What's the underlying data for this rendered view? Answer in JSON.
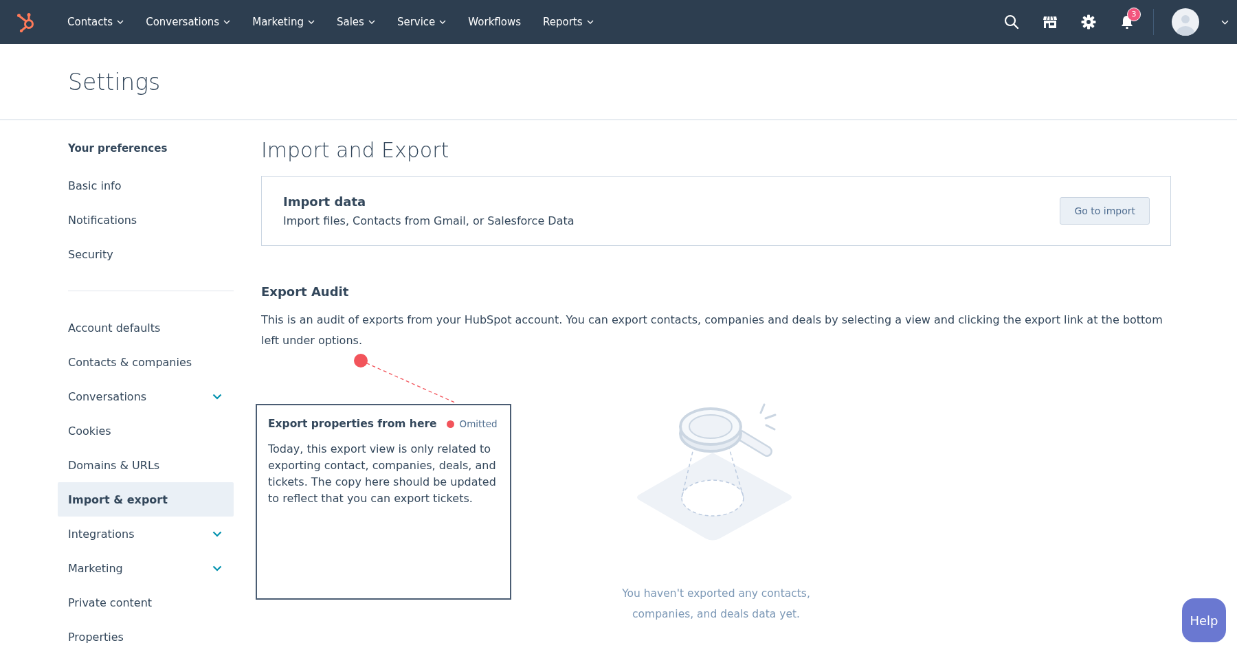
{
  "nav": {
    "items": [
      {
        "label": "Contacts",
        "has_menu": true
      },
      {
        "label": "Conversations",
        "has_menu": true
      },
      {
        "label": "Marketing",
        "has_menu": true
      },
      {
        "label": "Sales",
        "has_menu": true
      },
      {
        "label": "Service",
        "has_menu": true
      },
      {
        "label": "Workflows",
        "has_menu": false
      },
      {
        "label": "Reports",
        "has_menu": true
      }
    ],
    "notification_count": "3"
  },
  "page_title": "Settings",
  "sidebar": {
    "heading": "Your preferences",
    "groups": [
      [
        {
          "label": "Basic info",
          "expandable": false,
          "selected": false
        },
        {
          "label": "Notifications",
          "expandable": false,
          "selected": false
        },
        {
          "label": "Security",
          "expandable": false,
          "selected": false
        }
      ],
      [
        {
          "label": "Account defaults",
          "expandable": false,
          "selected": false
        },
        {
          "label": "Contacts & companies",
          "expandable": false,
          "selected": false
        },
        {
          "label": "Conversations",
          "expandable": true,
          "selected": false
        },
        {
          "label": "Cookies",
          "expandable": false,
          "selected": false
        },
        {
          "label": "Domains & URLs",
          "expandable": false,
          "selected": false
        },
        {
          "label": "Import & export",
          "expandable": false,
          "selected": true
        },
        {
          "label": "Integrations",
          "expandable": true,
          "selected": false
        },
        {
          "label": "Marketing",
          "expandable": true,
          "selected": false
        },
        {
          "label": "Private content",
          "expandable": false,
          "selected": false
        },
        {
          "label": "Properties",
          "expandable": false,
          "selected": false
        }
      ]
    ]
  },
  "main": {
    "title": "Import and Export",
    "import_card": {
      "title": "Import data",
      "description": "Import files, Contacts from Gmail, or Salesforce Data",
      "button": "Go to import"
    },
    "audit": {
      "heading": "Export Audit",
      "description": "This is an audit of exports from your HubSpot account. You can export contacts, companies and deals by selecting a view and clicking the export link at the bottom left under options.",
      "empty_message": "You haven't exported any contacts, companies, and deals data yet."
    }
  },
  "annotation": {
    "title": "Export properties from here",
    "status": "Omitted",
    "color": "#f2545b",
    "body": "Today, this export view is only related to exporting contact, companies, deals, and tickets. The copy here should be updated to reflect that you can export tickets."
  },
  "help_button": "Help"
}
